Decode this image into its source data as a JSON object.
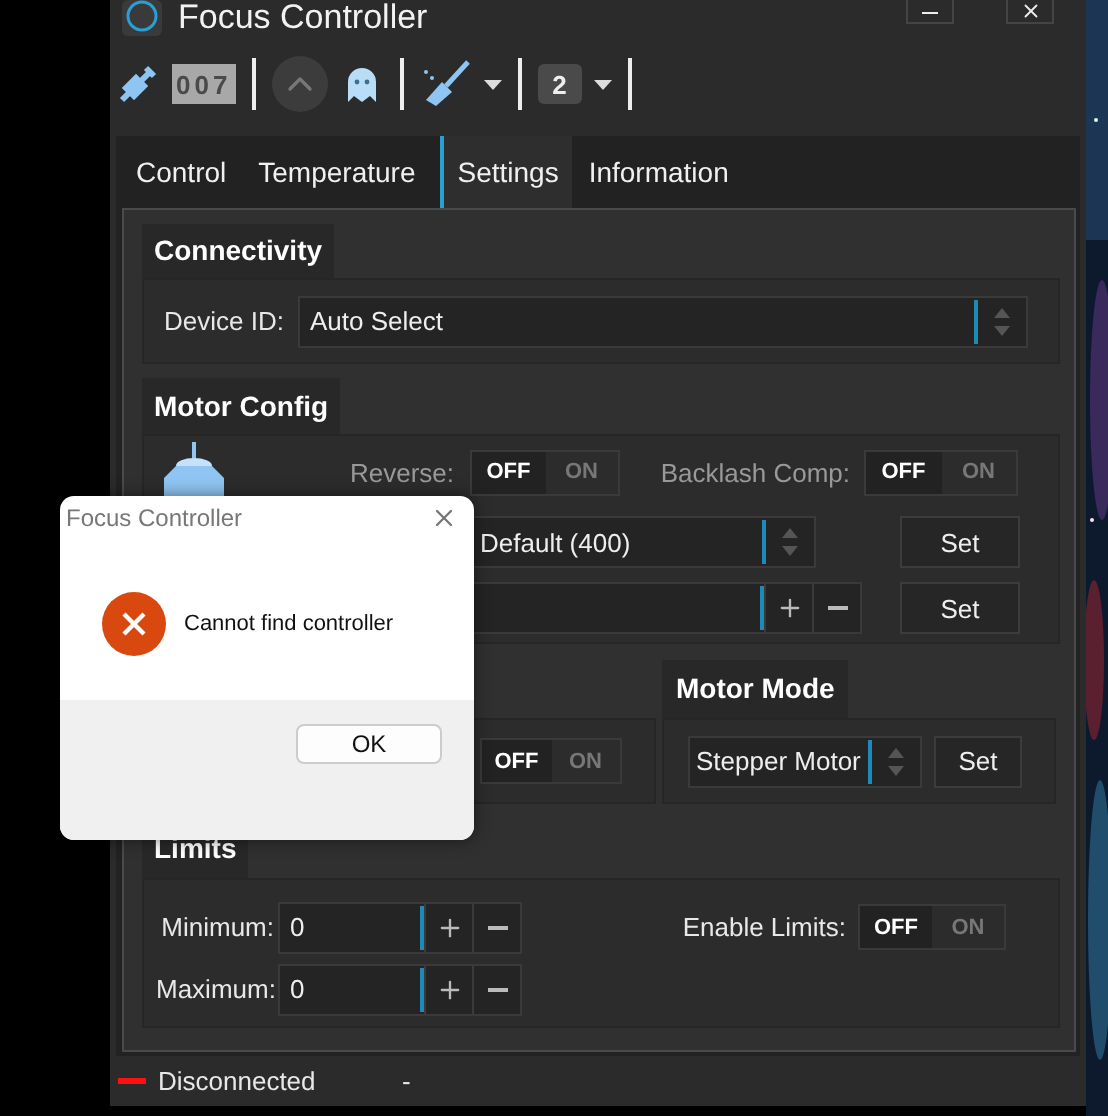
{
  "window": {
    "title": "Focus Controller"
  },
  "toolbar": {
    "counter": "007",
    "profile": "2"
  },
  "tabs": [
    {
      "label": "Control",
      "selected": false
    },
    {
      "label": "Temperature",
      "selected": false
    },
    {
      "label": "Settings",
      "selected": true
    },
    {
      "label": "Information",
      "selected": false
    }
  ],
  "connectivity": {
    "title": "Connectivity",
    "device_label": "Device ID:",
    "device_value": "Auto Select"
  },
  "motor_config": {
    "title": "Motor Config",
    "reverse": {
      "label": "Reverse:",
      "off": "OFF",
      "on_label": "ON",
      "on": false
    },
    "backlash": {
      "label": "Backlash Comp:",
      "off": "OFF",
      "on_label": "ON",
      "on": false
    },
    "step_value": "Default (400)",
    "set_buttons": [
      "Set",
      "Set"
    ]
  },
  "hidden_group": {
    "toggle": {
      "off": "OFF",
      "on_label": "ON",
      "on": false
    }
  },
  "motor_mode": {
    "title": "Motor Mode",
    "value": "Stepper Motor",
    "button": "Set"
  },
  "limits": {
    "title": "Limits",
    "minimum": {
      "label": "Minimum:",
      "value": "0"
    },
    "maximum": {
      "label": "Maximum:",
      "value": "0"
    },
    "enable": {
      "label": "Enable Limits:",
      "off": "OFF",
      "on_label": "ON",
      "on": false
    }
  },
  "status_bar": {
    "connected": false,
    "status": "Disconnected",
    "detail": "-"
  },
  "dialog": {
    "title": "Focus Controller",
    "message": "Cannot find controller",
    "button": "OK"
  }
}
